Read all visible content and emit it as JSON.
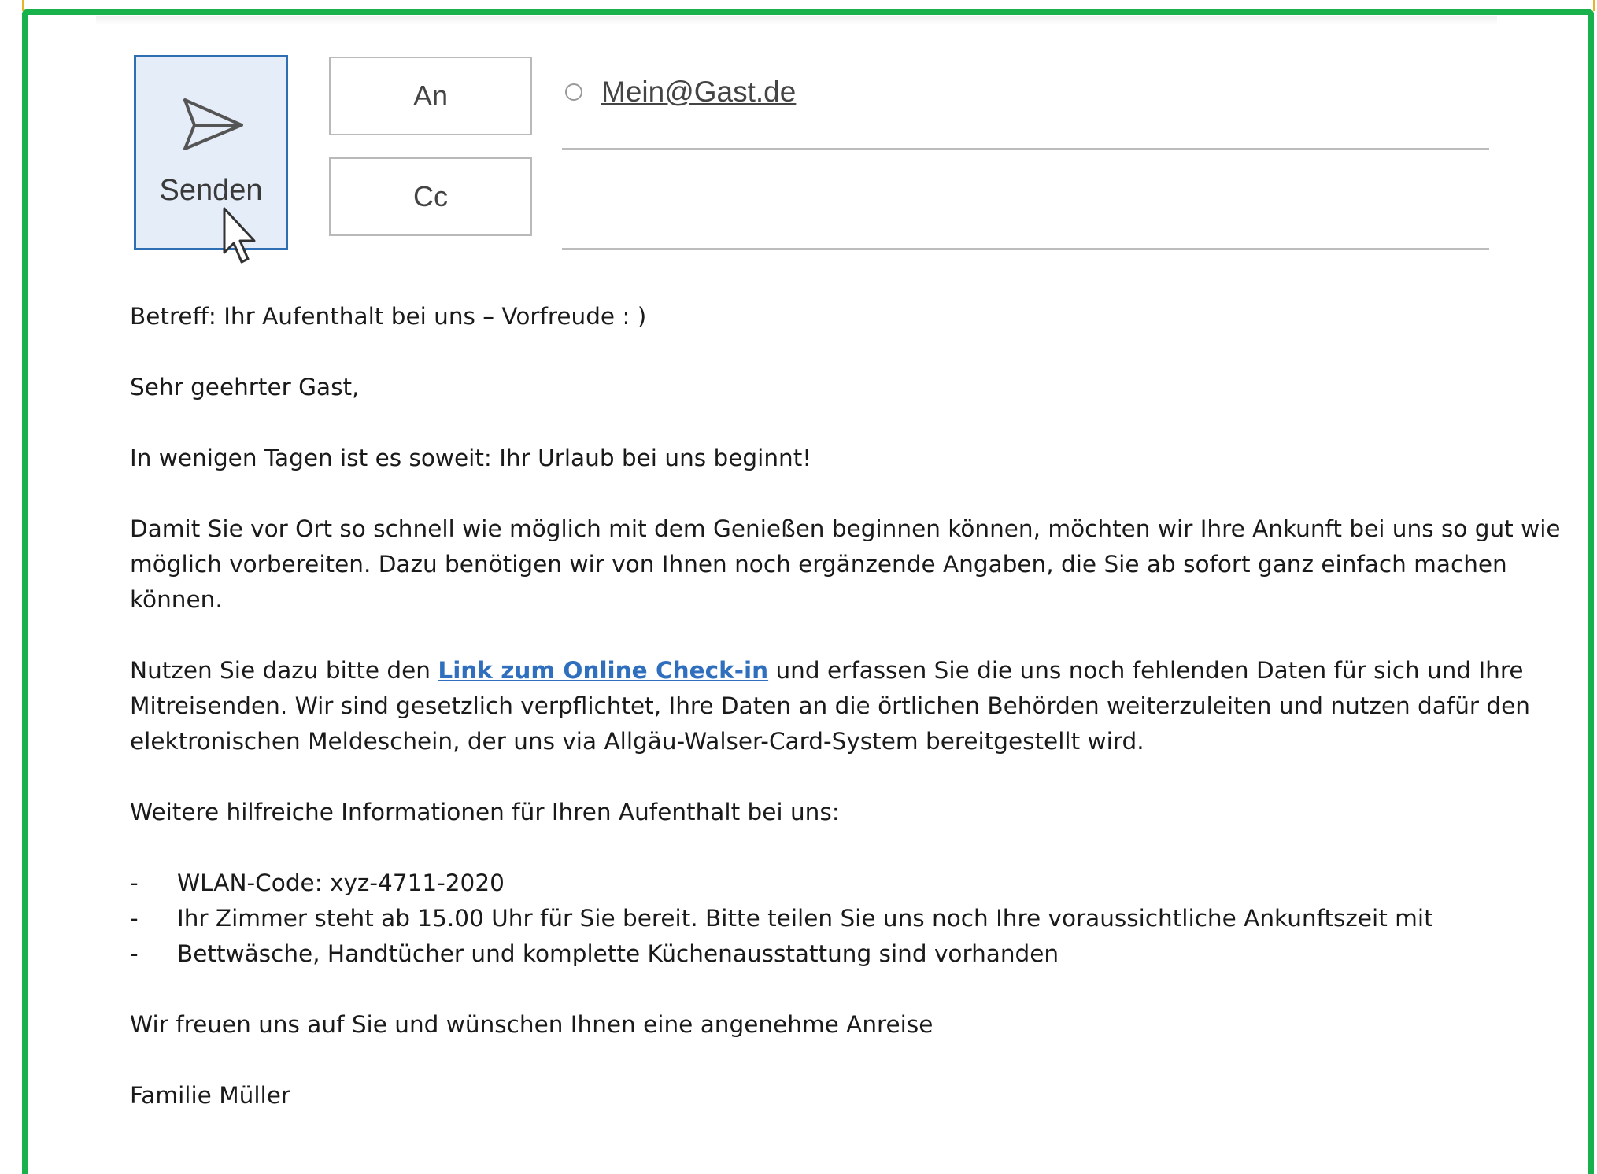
{
  "header": {
    "send_label": "Senden",
    "to_label": "An",
    "cc_label": "Cc",
    "recipient": "Mein@Gast.de"
  },
  "email": {
    "subject": "Betreff: Ihr Aufenthalt bei uns – Vorfreude : )",
    "greeting": "Sehr geehrter Gast,",
    "intro": "In wenigen Tagen ist es soweit: Ihr Urlaub bei uns beginnt!",
    "para1": "Damit Sie vor Ort so schnell wie möglich mit dem Genießen beginnen können, möchten wir Ihre Ankunft bei uns so gut wie möglich vorbereiten. Dazu benötigen wir von Ihnen noch ergänzende Angaben, die Sie ab sofort ganz einfach machen können.",
    "para2_before": "Nutzen Sie dazu bitte den ",
    "para2_link": "Link zum Online Check-in",
    "para2_after": " und erfassen Sie die uns noch fehlenden Daten für sich und Ihre Mitreisenden. Wir sind gesetzlich verpflichtet, Ihre Daten an die örtlichen Behörden weiterzuleiten und nutzen dafür den elektronischen Meldeschein, der uns via Allgäu-Walser-Card-System bereitgestellt wird.",
    "para3": "Weitere hilfreiche Informationen für Ihren Aufenthalt bei uns:",
    "list": [
      "WLAN-Code:  xyz-4711-2020",
      "Ihr Zimmer steht ab 15.00 Uhr für Sie bereit. Bitte teilen Sie uns noch Ihre voraussichtliche Ankunftszeit mit",
      "Bettwäsche, Handtücher und komplette Küchenausstattung sind vorhanden"
    ],
    "list_marker": "-",
    "closing": "Wir freuen uns auf Sie und wünschen Ihnen eine angenehme Anreise",
    "signature": "Familie Müller"
  },
  "colors": {
    "frame": "#19b14b",
    "link": "#2f6fbe",
    "send_button_border": "#2e6fb3"
  }
}
